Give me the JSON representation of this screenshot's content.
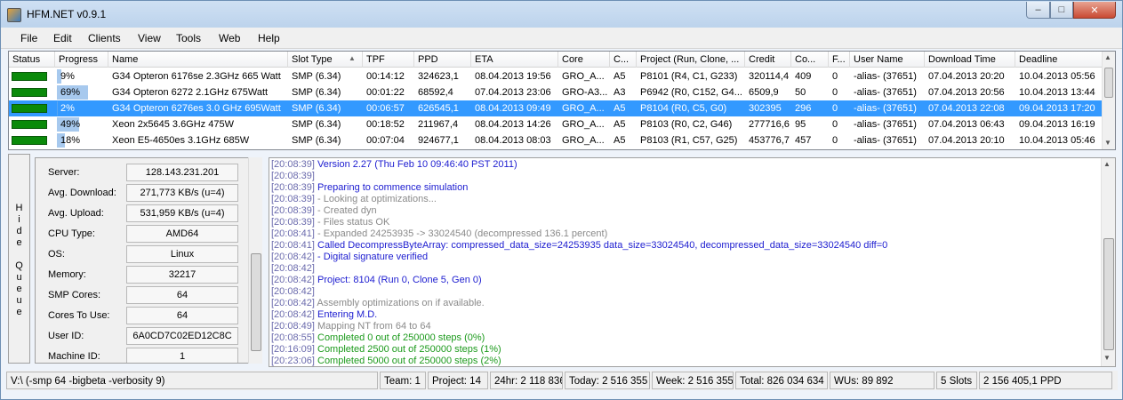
{
  "window": {
    "title": "HFM.NET v0.9.1",
    "min_glyph": "–",
    "max_glyph": "□",
    "close_glyph": "✕"
  },
  "menu": [
    "File",
    "Edit",
    "Clients",
    "View",
    "Tools",
    "Web",
    "Help"
  ],
  "columns": [
    "Status",
    "Progress",
    "Name",
    "Slot Type",
    "TPF",
    "PPD",
    "ETA",
    "Core",
    "C...",
    "Project (Run, Clone, ...",
    "Credit",
    "Co...",
    "F...",
    "User Name",
    "Download Time",
    "Deadline"
  ],
  "sort_indicator": "▲",
  "rows": [
    {
      "progress": "9%",
      "progress_value": 0.09,
      "name": "G34 Opteron 6176se 2.3GHz 665 Watt",
      "slot": "SMP (6.34)",
      "tpf": "00:14:12",
      "ppd": "324623,1",
      "eta": "08.04.2013 19:56",
      "core": "GRO_A...",
      "c": "A5",
      "project": "P8101 (R4, C1, G233)",
      "credit": "320114,4",
      "co": "409",
      "f": "0",
      "user": "-alias- (37651)",
      "download": "07.04.2013 20:20",
      "deadline": "10.04.2013 05:56"
    },
    {
      "progress": "69%",
      "progress_value": 0.69,
      "name": "G34 Opteron 6272 2.1GHz 675Watt",
      "slot": "SMP (6.34)",
      "tpf": "00:01:22",
      "ppd": "68592,4",
      "eta": "07.04.2013 23:06",
      "core": "GRO-A3...",
      "c": "A3",
      "project": "P6942 (R0, C152, G4...",
      "credit": "6509,9",
      "co": "50",
      "f": "0",
      "user": "-alias- (37651)",
      "download": "07.04.2013 20:56",
      "deadline": "10.04.2013 13:44"
    },
    {
      "progress": "2%",
      "progress_value": 0.02,
      "name": "G34 Opteron 6276es 3.0 GHz 695Watt",
      "slot": "SMP (6.34)",
      "tpf": "00:06:57",
      "ppd": "626545,1",
      "eta": "08.04.2013 09:49",
      "core": "GRO_A...",
      "c": "A5",
      "project": "P8104 (R0, C5, G0)",
      "credit": "302395",
      "co": "296",
      "f": "0",
      "user": "-alias- (37651)",
      "download": "07.04.2013 22:08",
      "deadline": "09.04.2013 17:20"
    },
    {
      "progress": "49%",
      "progress_value": 0.49,
      "name": "Xeon 2x5645 3.6GHz 475W",
      "slot": "SMP (6.34)",
      "tpf": "00:18:52",
      "ppd": "211967,4",
      "eta": "08.04.2013 14:26",
      "core": "GRO_A...",
      "c": "A5",
      "project": "P8103 (R0, C2, G46)",
      "credit": "277716,6",
      "co": "95",
      "f": "0",
      "user": "-alias- (37651)",
      "download": "07.04.2013 06:43",
      "deadline": "09.04.2013 16:19"
    },
    {
      "progress": "18%",
      "progress_value": 0.18,
      "name": "Xeon E5-4650es 3.1GHz 685W",
      "slot": "SMP (6.34)",
      "tpf": "00:07:04",
      "ppd": "924677,1",
      "eta": "08.04.2013 08:03",
      "core": "GRO_A...",
      "c": "A5",
      "project": "P8103 (R1, C57, G25)",
      "credit": "453776,7",
      "co": "457",
      "f": "0",
      "user": "-alias- (37651)",
      "download": "07.04.2013 20:10",
      "deadline": "10.04.2013 05:46"
    }
  ],
  "selected_row": 2,
  "hide_queue": [
    "H",
    "i",
    "d",
    "e",
    "",
    "Q",
    "u",
    "e",
    "u",
    "e"
  ],
  "info": [
    {
      "label": "Server:",
      "value": "128.143.231.201"
    },
    {
      "label": "Avg. Download:",
      "value": "271,773 KB/s (u=4)"
    },
    {
      "label": "Avg. Upload:",
      "value": "531,959 KB/s (u=4)"
    },
    {
      "label": "CPU Type:",
      "value": "AMD64"
    },
    {
      "label": "OS:",
      "value": "Linux"
    },
    {
      "label": "Memory:",
      "value": "32217"
    },
    {
      "label": "SMP Cores:",
      "value": "64"
    },
    {
      "label": "Cores To Use:",
      "value": "64"
    },
    {
      "label": "User ID:",
      "value": "6A0CD7C02ED12C8C"
    },
    {
      "label": "Machine ID:",
      "value": "1"
    }
  ],
  "log": [
    {
      "time": "[20:08:39]",
      "text": " Version 2.27 (Thu Feb 10 09:46:40 PST 2011)",
      "color": "blue"
    },
    {
      "time": "[20:08:39]",
      "text": "",
      "color": "gray"
    },
    {
      "time": "[20:08:39]",
      "text": " Preparing to commence simulation",
      "color": "blue"
    },
    {
      "time": "[20:08:39]",
      "text": " - Looking at optimizations...",
      "color": "gray"
    },
    {
      "time": "[20:08:39]",
      "text": " - Created dyn",
      "color": "gray"
    },
    {
      "time": "[20:08:39]",
      "text": " - Files status OK",
      "color": "gray"
    },
    {
      "time": "[20:08:41]",
      "text": " - Expanded 24253935 -> 33024540 (decompressed 136.1 percent)",
      "color": "gray"
    },
    {
      "time": "[20:08:41]",
      "text": " Called DecompressByteArray: compressed_data_size=24253935 data_size=33024540, decompressed_data_size=33024540 diff=0",
      "color": "blue"
    },
    {
      "time": "[20:08:42]",
      "text": " - Digital signature verified",
      "color": "blue"
    },
    {
      "time": "[20:08:42]",
      "text": "",
      "color": "gray"
    },
    {
      "time": "[20:08:42]",
      "text": " Project: 8104 (Run 0, Clone 5, Gen 0)",
      "color": "blue"
    },
    {
      "time": "[20:08:42]",
      "text": "",
      "color": "gray"
    },
    {
      "time": "[20:08:42]",
      "text": " Assembly optimizations on if available.",
      "color": "gray"
    },
    {
      "time": "[20:08:42]",
      "text": " Entering M.D.",
      "color": "blue"
    },
    {
      "time": "[20:08:49]",
      "text": " Mapping NT from 64 to 64",
      "color": "gray"
    },
    {
      "time": "[20:08:55]",
      "text": " Completed 0 out of 250000 steps  (0%)",
      "color": "green"
    },
    {
      "time": "[20:16:09]",
      "text": " Completed 2500 out of 250000 steps  (1%)",
      "color": "green"
    },
    {
      "time": "[20:23:06]",
      "text": " Completed 5000 out of 250000 steps  (2%)",
      "color": "green"
    }
  ],
  "status": {
    "path": "V:\\ (-smp 64 -bigbeta -verbosity 9)",
    "team": "Team: 1",
    "project": "Project: 14",
    "h24": "24hr: 2 118 836",
    "today": "Today: 2 516 355",
    "week": "Week: 2 516 355",
    "total": "Total: 826 034 634",
    "wus": "WUs: 89 892",
    "slots": "5 Slots",
    "ppd": "2 156 405,1 PPD"
  },
  "colors": {
    "accent": "#3399ff",
    "status_running": "#0a8a0a",
    "progress_fill": "#a7c9ee",
    "log_blue": "#1c1cd0",
    "log_green": "#1c9a1c",
    "log_gray": "#8a8a8a"
  }
}
